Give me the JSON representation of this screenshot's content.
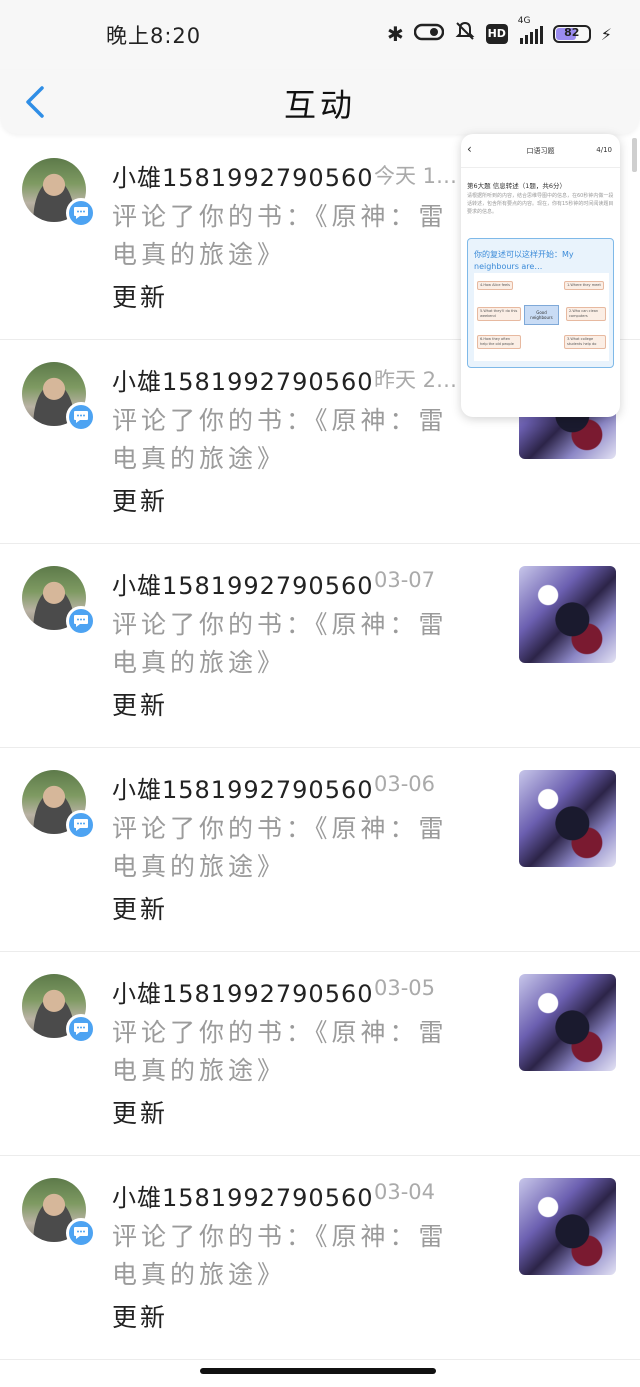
{
  "status_bar": {
    "time": "晚上8:20",
    "network": "4G",
    "hd": "HD",
    "battery": "82"
  },
  "header": {
    "title": "互动"
  },
  "items": [
    {
      "username": "小雄1581992790560",
      "time": "今天 1…",
      "comment": "评论了你的书：《原神：雷电真的旅途》",
      "action": "更新"
    },
    {
      "username": "小雄1581992790560",
      "time": "昨天 2…",
      "comment": "评论了你的书：《原神：雷电真的旅途》",
      "action": "更新"
    },
    {
      "username": "小雄1581992790560",
      "time": "03-07",
      "comment": "评论了你的书：《原神：雷电真的旅途》",
      "action": "更新"
    },
    {
      "username": "小雄1581992790560",
      "time": "03-06",
      "comment": "评论了你的书：《原神：雷电真的旅途》",
      "action": "更新"
    },
    {
      "username": "小雄1581992790560",
      "time": "03-05",
      "comment": "评论了你的书：《原神：雷电真的旅途》",
      "action": "更新"
    },
    {
      "username": "小雄1581992790560",
      "time": "03-04",
      "comment": "评论了你的书：《原神：雷电真的旅途》",
      "action": "更新"
    }
  ],
  "floating_window": {
    "title": "口语习题",
    "count": "4/10",
    "question": "第6大题 信息转述（1题，共6分）",
    "description": "请根据所听到的内容，结合思维导图中的信息，在60秒钟内做一段话转述，包含所有要点的内容。现在，你有15秒钟的时间阅读题目要求的信息。",
    "card_title": "你的复述可以这样开始：My neighbours are…",
    "center_node": "Good neighbours",
    "nodes": [
      "1.Where they meet",
      "2.Who can clean computers",
      "3.What college students help do",
      "4.How Alice feels",
      "5.What they'll do this weekend",
      "6.How they often help the old people"
    ]
  },
  "colors": {
    "accent": "#4da3f2",
    "muted_text": "#9b9b9b"
  }
}
